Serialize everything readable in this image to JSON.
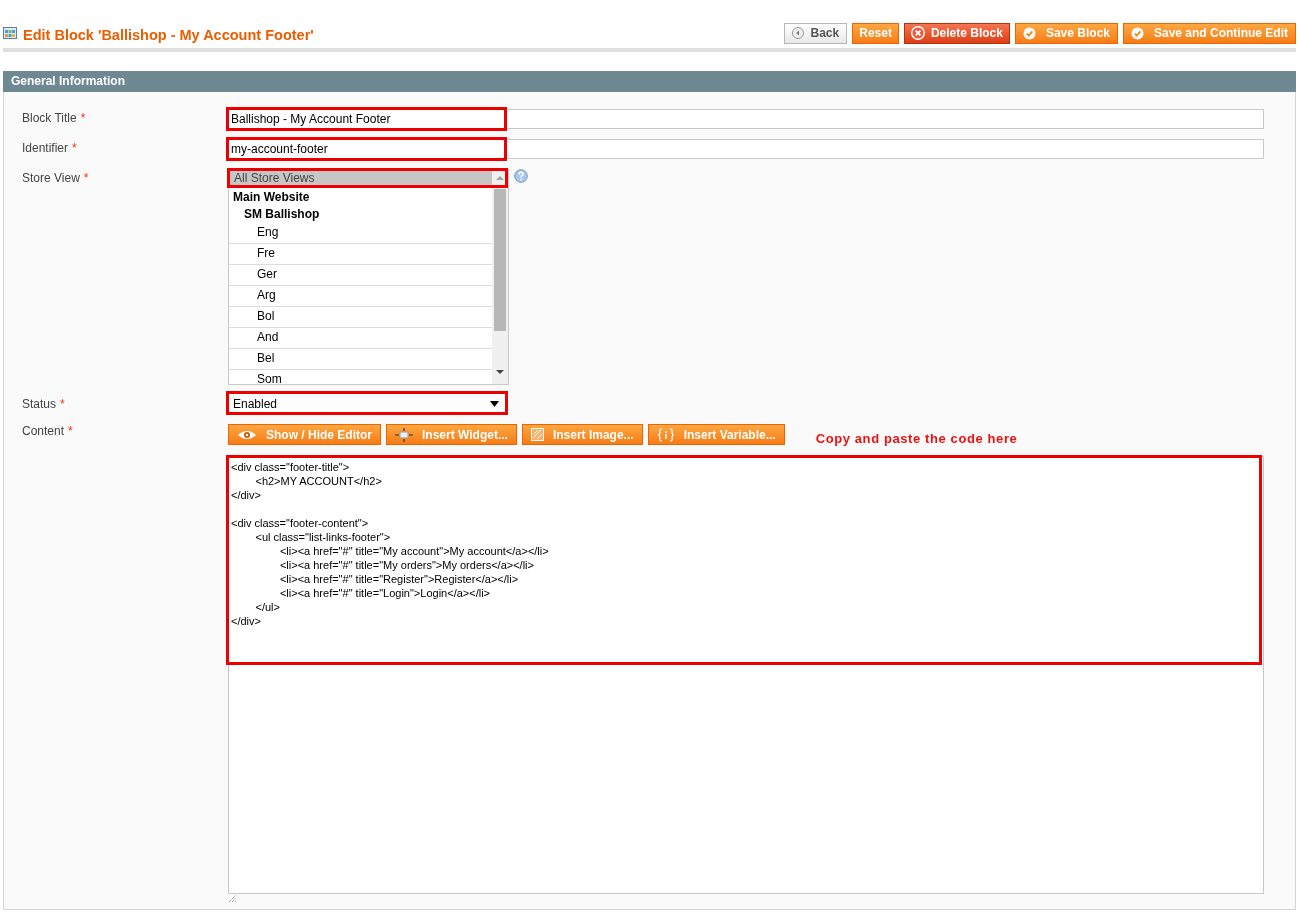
{
  "header": {
    "title": "Edit Block 'Ballishop - My Account Footer'",
    "buttons": [
      {
        "label": "Back",
        "kind": "back"
      },
      {
        "label": "Reset",
        "kind": "plain"
      },
      {
        "label": "Delete Block",
        "kind": "delete"
      },
      {
        "label": "Save Block",
        "kind": "save"
      },
      {
        "label": "Save and Continue Edit",
        "kind": "save"
      }
    ]
  },
  "section": {
    "title": "General Information"
  },
  "fields": [
    {
      "kind": "text",
      "label": "Block Title",
      "mark": "*",
      "value": "Ballishop - My Account Footer",
      "highlighted": true
    },
    {
      "kind": "text",
      "label": "Identifier",
      "mark": "*",
      "value": "my-account-footer",
      "highlighted": true
    },
    {
      "kind": "multiselect",
      "label": "Store View",
      "mark": "*",
      "highlighted": true,
      "options": [
        {
          "label": "All Store Views",
          "selected": true
        },
        {
          "label": "Main Website",
          "selected": false,
          "children": [
            {
              "label": "SM Ballishop",
              "selected": false,
              "children": [
                {
                  "label": "Eng",
                  "selected": false
                },
                {
                  "label": "Fre",
                  "selected": false
                },
                {
                  "label": "Ger",
                  "selected": false
                },
                {
                  "label": "Arg",
                  "selected": false
                },
                {
                  "label": "Bol",
                  "selected": false
                },
                {
                  "label": "And",
                  "selected": false
                },
                {
                  "label": "Bel",
                  "selected": false
                },
                {
                  "label": "Som",
                  "selected": false
                }
              ]
            }
          ]
        }
      ]
    },
    {
      "kind": "select",
      "label": "Status",
      "mark": "*",
      "value": "Enabled",
      "highlighted": true
    },
    {
      "kind": "editor",
      "label": "Content",
      "mark": "*",
      "highlighted": true,
      "buttons": [
        {
          "label": "Show / Hide Editor",
          "kind": "eye"
        },
        {
          "label": "Insert Widget...",
          "kind": "widget"
        },
        {
          "label": "Insert Image...",
          "kind": "image"
        },
        {
          "label": "Insert Variable...",
          "kind": "variable"
        }
      ],
      "note": "Copy and paste the code here",
      "value": "<div class=\"footer-title\">\n\t<h2>MY ACCOUNT</h2>\n</div>\n\n<div class=\"footer-content\">\n\t<ul class=\"list-links-footer\">\n\t\t<li><a href=\"#\" title=\"My account\">My account</a></li>\n\t\t<li><a href=\"#\" title=\"My orders\">My orders</a></li>\n\t\t<li><a href=\"#\" title=\"Register\">Register</a></li>\n\t\t<li><a href=\"#\" title=\"Login\">Login</a></li>\n\t</ul>\n</div>"
    }
  ]
}
